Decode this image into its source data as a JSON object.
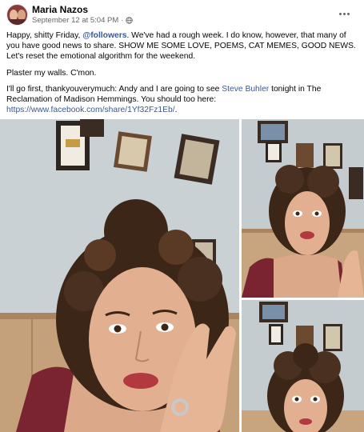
{
  "post": {
    "author": "Maria Nazos",
    "date": "September 12 at 5:04 PM",
    "separator": "·",
    "visibility_icon": "globe-icon",
    "more_icon": "more-options-icon",
    "paragraph1_part1": "Happy, shitty Friday, ",
    "mention": "@followers",
    "paragraph1_part2": ". We've had a rough week. I do know, however, that many of you have good news to share. SHOW ME SOME LOVE, POEMS, CAT MEMES, GOOD NEWS. Let's reset the emotional algorithm for the weekend.",
    "paragraph2": "Plaster my walls. C'mon.",
    "paragraph3_part1": "I'll go first, thankyouverymuch: Andy and I are going to see ",
    "artist_link": "Steve Buhler",
    "paragraph3_part2": " tonight in The Reclamation of Madison Hemmings. You should too here: ",
    "share_link": "https://www.facebook.com/share/1Yf32Fz1Eb/",
    "paragraph3_end": "."
  },
  "colors": {
    "link": "#385898",
    "meta": "#65676b",
    "wall": "#cbd3d6",
    "wood": "#c7a57f",
    "shirt": "#7a2431",
    "skin": "#e2b091",
    "hair": "#3b2618"
  },
  "photos": [
    {
      "name": "photo-blowing-kiss"
    },
    {
      "name": "photo-surprised-face"
    },
    {
      "name": "photo-wide-eyes"
    }
  ]
}
